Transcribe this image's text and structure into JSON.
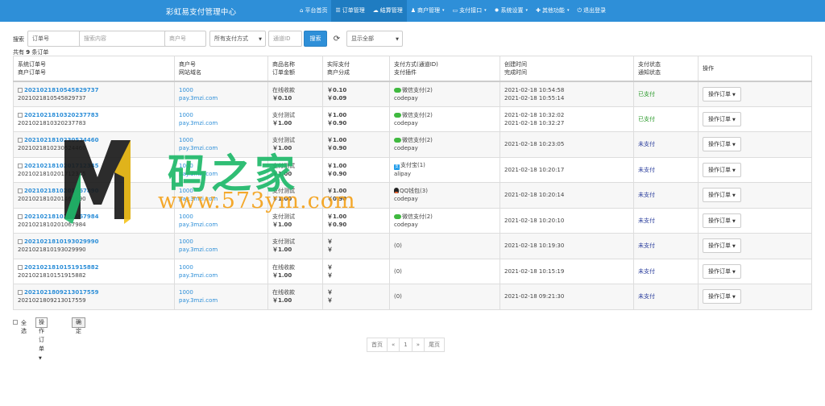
{
  "app": {
    "title": "彩虹易支付管理中心"
  },
  "nav": [
    {
      "icon": "home-icon",
      "glyph": "⌂",
      "label": "平台首页",
      "active": false,
      "caret": false
    },
    {
      "icon": "list-icon",
      "glyph": "☰",
      "label": "订单管理",
      "active": true,
      "caret": false
    },
    {
      "icon": "cloud-icon",
      "glyph": "☁",
      "label": "结算管理",
      "active": true,
      "caret": false
    },
    {
      "icon": "user-icon",
      "glyph": "♟",
      "label": "商户管理",
      "active": false,
      "caret": true
    },
    {
      "icon": "card-icon",
      "glyph": "▭",
      "label": "支付接口",
      "active": false,
      "caret": true
    },
    {
      "icon": "gear-icon",
      "glyph": "✹",
      "label": "系统设置",
      "active": false,
      "caret": true
    },
    {
      "icon": "tasks-icon",
      "glyph": "✚",
      "label": "其他功能",
      "active": false,
      "caret": true
    },
    {
      "icon": "power-icon",
      "glyph": "⏻",
      "label": "退出登录",
      "active": false,
      "caret": false
    }
  ],
  "search": {
    "label": "搜索",
    "type_value": "订单号",
    "content_placeholder": "搜索内容",
    "merchant_placeholder": "商户号",
    "method_value": "所有支付方式",
    "channel_placeholder": "通道ID",
    "button": "搜索",
    "refresh": "⟳",
    "display_value": "显示全部"
  },
  "total": {
    "prefix": "共有",
    "count": "9",
    "suffix": "条订单"
  },
  "table": {
    "headers": [
      [
        "系统订单号",
        "商户订单号"
      ],
      [
        "商户号",
        "网站域名"
      ],
      [
        "商品名称",
        "订单金额"
      ],
      [
        "实际支付",
        "商户分成"
      ],
      [
        "支付方式(通道ID)",
        "支付插件"
      ],
      [
        "创建时间",
        "完成时间"
      ],
      [
        "支付状态",
        "通知状态"
      ],
      [
        "操作"
      ]
    ],
    "rows": [
      {
        "sys": "2021021810545829737",
        "mer": "2021021810545829737",
        "uid": "1000",
        "site": "pay.3mzi.com",
        "name": "在线收款",
        "money": "￥0.10",
        "real": "￥0.10",
        "share": "￥0.09",
        "pay_icon": "wechat",
        "pay": "微信支付(2)",
        "plugin": "codepay",
        "created": "2021-02-18 10:54:58",
        "finished": "2021-02-18 10:55:14",
        "status": "已支付",
        "paid": true,
        "op": "操作订单"
      },
      {
        "sys": "2021021810320237783",
        "mer": "2021021810320237783",
        "uid": "1000",
        "site": "pay.3mzi.com",
        "name": "支付测试",
        "money": "￥1.00",
        "real": "￥1.00",
        "share": "￥0.90",
        "pay_icon": "wechat",
        "pay": "微信支付(2)",
        "plugin": "codepay",
        "created": "2021-02-18 10:32:02",
        "finished": "2021-02-18 10:32:27",
        "status": "已支付",
        "paid": true,
        "op": "操作订单"
      },
      {
        "sys": "2021021810230524460",
        "mer": "2021021810230524460",
        "uid": "1000",
        "site": "pay.3mzi.com",
        "name": "支付测试",
        "money": "￥1.00",
        "real": "￥1.00",
        "share": "￥0.90",
        "pay_icon": "wechat",
        "pay": "微信支付(2)",
        "plugin": "codepay",
        "created": "2021-02-18 10:23:05",
        "finished": "",
        "status": "未支付",
        "paid": false,
        "op": "操作订单"
      },
      {
        "sys": "2021021810201712345",
        "mer": "2021021810201712345",
        "uid": "1000",
        "site": "pay.3mzi.com",
        "name": "支付测试",
        "money": "￥1.00",
        "real": "￥1.00",
        "share": "￥0.90",
        "pay_icon": "alipay",
        "pay": "支付宝(1)",
        "plugin": "alipay",
        "created": "2021-02-18 10:20:17",
        "finished": "",
        "status": "未支付",
        "paid": false,
        "op": "操作订单"
      },
      {
        "sys": "2021021810201467890",
        "mer": "2021021810201467890",
        "uid": "1000",
        "site": "pay.3mzi.com",
        "name": "支付测试",
        "money": "￥1.00",
        "real": "￥1.00",
        "share": "￥0.90",
        "pay_icon": "qq",
        "pay": "QQ钱包(3)",
        "plugin": "codepay",
        "created": "2021-02-18 10:20:14",
        "finished": "",
        "status": "未支付",
        "paid": false,
        "op": "操作订单"
      },
      {
        "sys": "2021021810201067984",
        "mer": "2021021810201067984",
        "uid": "1000",
        "site": "pay.3mzi.com",
        "name": "支付测试",
        "money": "￥1.00",
        "real": "￥1.00",
        "share": "￥0.90",
        "pay_icon": "wechat",
        "pay": "微信支付(2)",
        "plugin": "codepay",
        "created": "2021-02-18 10:20:10",
        "finished": "",
        "status": "未支付",
        "paid": false,
        "op": "操作订单"
      },
      {
        "sys": "2021021810193029990",
        "mer": "2021021810193029990",
        "uid": "1000",
        "site": "pay.3mzi.com",
        "name": "支付测试",
        "money": "￥1.00",
        "real": "￥",
        "share": "￥",
        "pay_icon": "",
        "pay": "(0)",
        "plugin": "",
        "created": "2021-02-18 10:19:30",
        "finished": "",
        "status": "未支付",
        "paid": false,
        "op": "操作订单"
      },
      {
        "sys": "2021021810151915882",
        "mer": "2021021810151915882",
        "uid": "1000",
        "site": "pay.3mzi.com",
        "name": "在线收款",
        "money": "￥1.00",
        "real": "￥",
        "share": "￥",
        "pay_icon": "",
        "pay": "(0)",
        "plugin": "",
        "created": "2021-02-18 10:15:19",
        "finished": "",
        "status": "未支付",
        "paid": false,
        "op": "操作订单"
      },
      {
        "sys": "2021021809213017559",
        "mer": "2021021809213017559",
        "uid": "1000",
        "site": "pay.3mzi.com",
        "name": "在线收款",
        "money": "￥1.00",
        "real": "￥",
        "share": "￥",
        "pay_icon": "",
        "pay": "(0)",
        "plugin": "",
        "created": "2021-02-18 09:21:30",
        "finished": "",
        "status": "未支付",
        "paid": false,
        "op": "操作订单"
      }
    ]
  },
  "bulk": {
    "select_all": "全选",
    "action": "操作订单",
    "confirm": "确定"
  },
  "pager": [
    "首页",
    "«",
    "1",
    "»",
    "尾页"
  ],
  "watermark": {
    "text": "码之家",
    "url": "www.573ym.com"
  },
  "colors": {
    "brand": "#2e8fd8",
    "paid": "#2b9a2b",
    "unpaid": "#2a3d9c"
  }
}
